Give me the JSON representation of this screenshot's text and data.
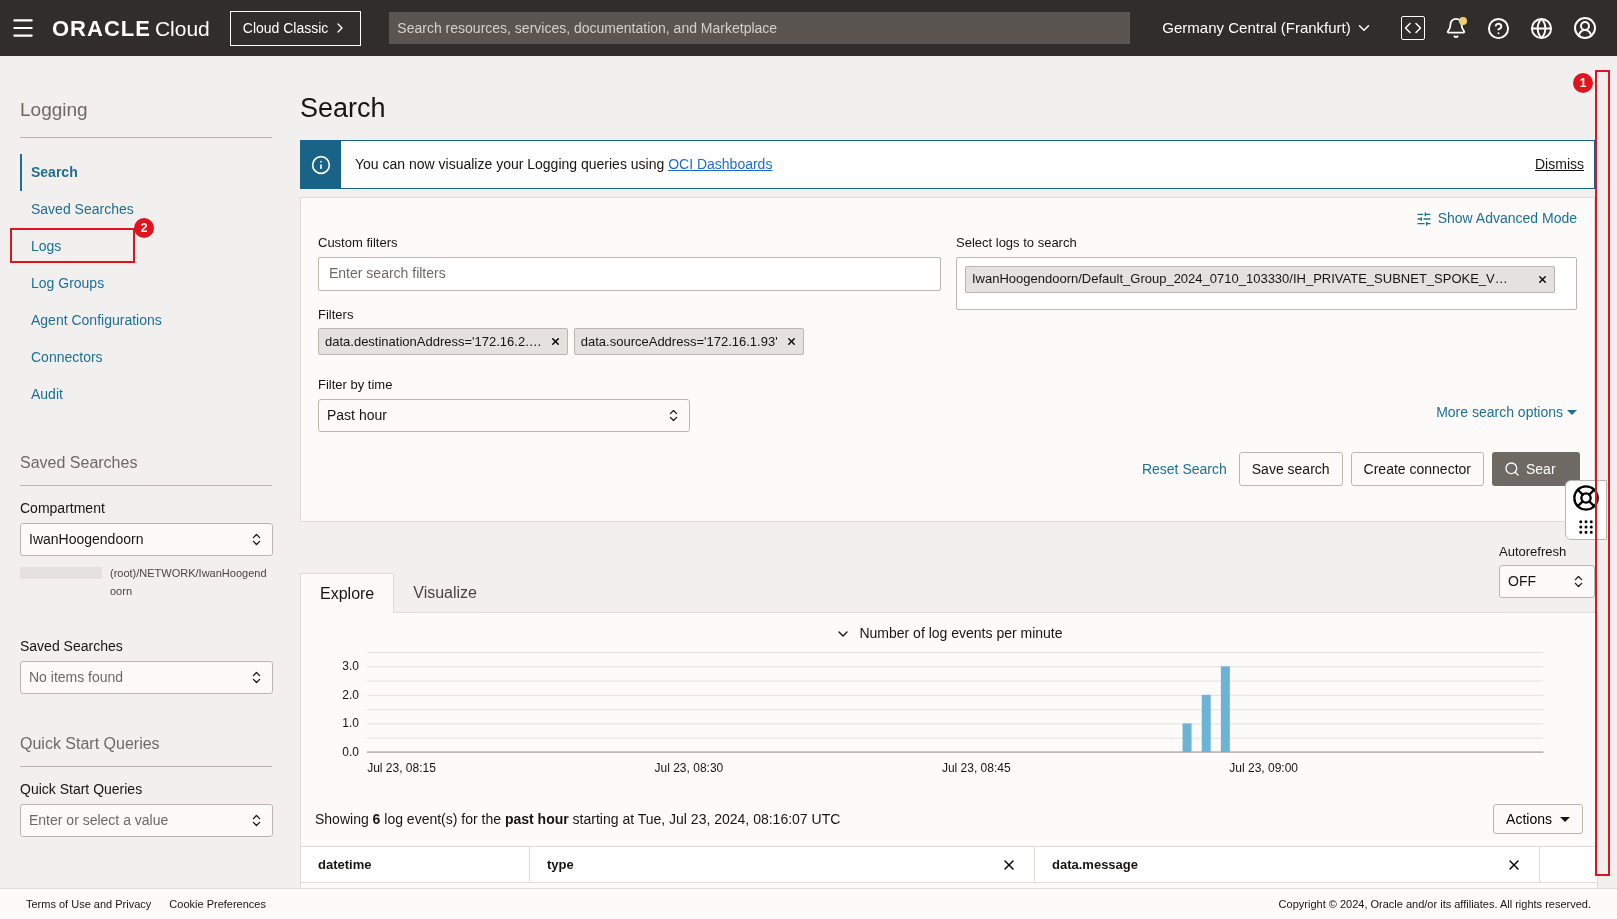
{
  "header": {
    "brand": "ORACLE",
    "brand_suffix": "Cloud",
    "classic_button": "Cloud Classic",
    "search_placeholder": "Search resources, services, documentation, and Marketplace",
    "region": "Germany Central (Frankfurt)",
    "has_notification": true
  },
  "sidebar": {
    "title": "Logging",
    "nav": [
      {
        "label": "Search",
        "selected": true
      },
      {
        "label": "Saved Searches",
        "selected": false
      },
      {
        "label": "Logs",
        "selected": false,
        "callout": "2"
      },
      {
        "label": "Log Groups",
        "selected": false
      },
      {
        "label": "Agent Configurations",
        "selected": false
      },
      {
        "label": "Connectors",
        "selected": false
      },
      {
        "label": "Audit",
        "selected": false
      }
    ],
    "sections": [
      {
        "heading": "Saved Searches",
        "fields": [
          {
            "label": "Compartment",
            "value": "IwanHoogendoorn",
            "path": "(root)/NETWORK/IwanHoogendoorn"
          },
          {
            "label": "Saved Searches",
            "placeholder": "No items found"
          }
        ]
      },
      {
        "heading": "Quick Start Queries",
        "fields": [
          {
            "label": "Quick Start Queries",
            "placeholder": "Enter or select a value"
          }
        ]
      }
    ]
  },
  "main": {
    "title": "Search",
    "scroll_callout": "1",
    "banner": {
      "text": "You can now visualize your Logging queries using ",
      "link": "OCI Dashboards",
      "dismiss": "Dismiss"
    },
    "query": {
      "advanced_mode": "Show Advanced Mode",
      "custom_filters": {
        "label": "Custom filters",
        "placeholder": "Enter search filters"
      },
      "filters": {
        "label": "Filters",
        "chips": [
          "data.destinationAddress='172.16.2.…",
          "data.sourceAddress='172.16.1.93'"
        ]
      },
      "time": {
        "label": "Filter by time",
        "value": "Past hour"
      },
      "logs": {
        "label": "Select logs to search",
        "chips": [
          "IwanHoogendoorn/Default_Group_2024_0710_103330/IH_PRIVATE_SUBNET_SPOKE_V…"
        ]
      },
      "more_options": "More search options",
      "buttons": [
        {
          "label": "Reset Search",
          "kind": "link"
        },
        {
          "label": "Save search",
          "kind": "secondary"
        },
        {
          "label": "Create connector",
          "kind": "secondary"
        },
        {
          "label": "Sear",
          "kind": "primary"
        }
      ]
    },
    "autorefresh": {
      "label": "Autorefresh",
      "value": "OFF"
    },
    "tabs": [
      {
        "label": "Explore",
        "selected": true
      },
      {
        "label": "Visualize",
        "selected": false
      }
    ],
    "chart_title": "Number of log events per minute",
    "chart_data": {
      "type": "bar",
      "ylim": [
        0,
        3.5
      ],
      "grid": true,
      "categories": [
        "Jul 23, 08:15",
        null,
        null,
        null,
        null,
        null,
        null,
        null,
        null,
        null,
        null,
        null,
        null,
        null,
        null,
        "Jul 23, 08:30",
        null,
        null,
        null,
        null,
        null,
        null,
        null,
        null,
        null,
        null,
        null,
        null,
        null,
        null,
        "Jul 23, 08:45",
        null,
        null,
        null,
        null,
        null,
        null,
        null,
        null,
        null,
        null,
        null,
        null,
        null,
        null,
        "Jul 23, 09:00",
        null,
        null,
        null,
        null,
        null,
        null,
        null,
        null,
        null,
        null,
        null,
        null,
        null,
        null,
        null
      ],
      "values": [
        null,
        null,
        null,
        null,
        null,
        null,
        null,
        null,
        null,
        null,
        null,
        null,
        null,
        null,
        null,
        null,
        null,
        null,
        null,
        null,
        null,
        null,
        null,
        null,
        null,
        null,
        null,
        null,
        null,
        null,
        null,
        null,
        null,
        null,
        null,
        null,
        null,
        null,
        null,
        null,
        null,
        1,
        2,
        3,
        null,
        null,
        null,
        null,
        null,
        null,
        null,
        null,
        null,
        null,
        null,
        null,
        null,
        null,
        null,
        null,
        null
      ],
      "yticks": [
        {
          "value": 0,
          "label": "0.0"
        },
        {
          "value": 1,
          "label": "1.0"
        },
        {
          "value": 2,
          "label": "2.0"
        },
        {
          "value": 3,
          "label": "3.0"
        }
      ]
    },
    "summary": "Showing **6** log event(s) for the **past hour** starting at Tue, Jul 23, 2024, 08:16:07 UTC",
    "actions": "Actions",
    "columns": [
      {
        "label": "datetime",
        "removable": false
      },
      {
        "label": "type",
        "removable": true
      },
      {
        "label": "data.message",
        "removable": true
      }
    ]
  },
  "footer": {
    "links": [
      "Terms of Use and Privacy",
      "Cookie Preferences"
    ],
    "copyright": "Copyright © 2024, Oracle and/or its affiliates. All rights reserved."
  }
}
